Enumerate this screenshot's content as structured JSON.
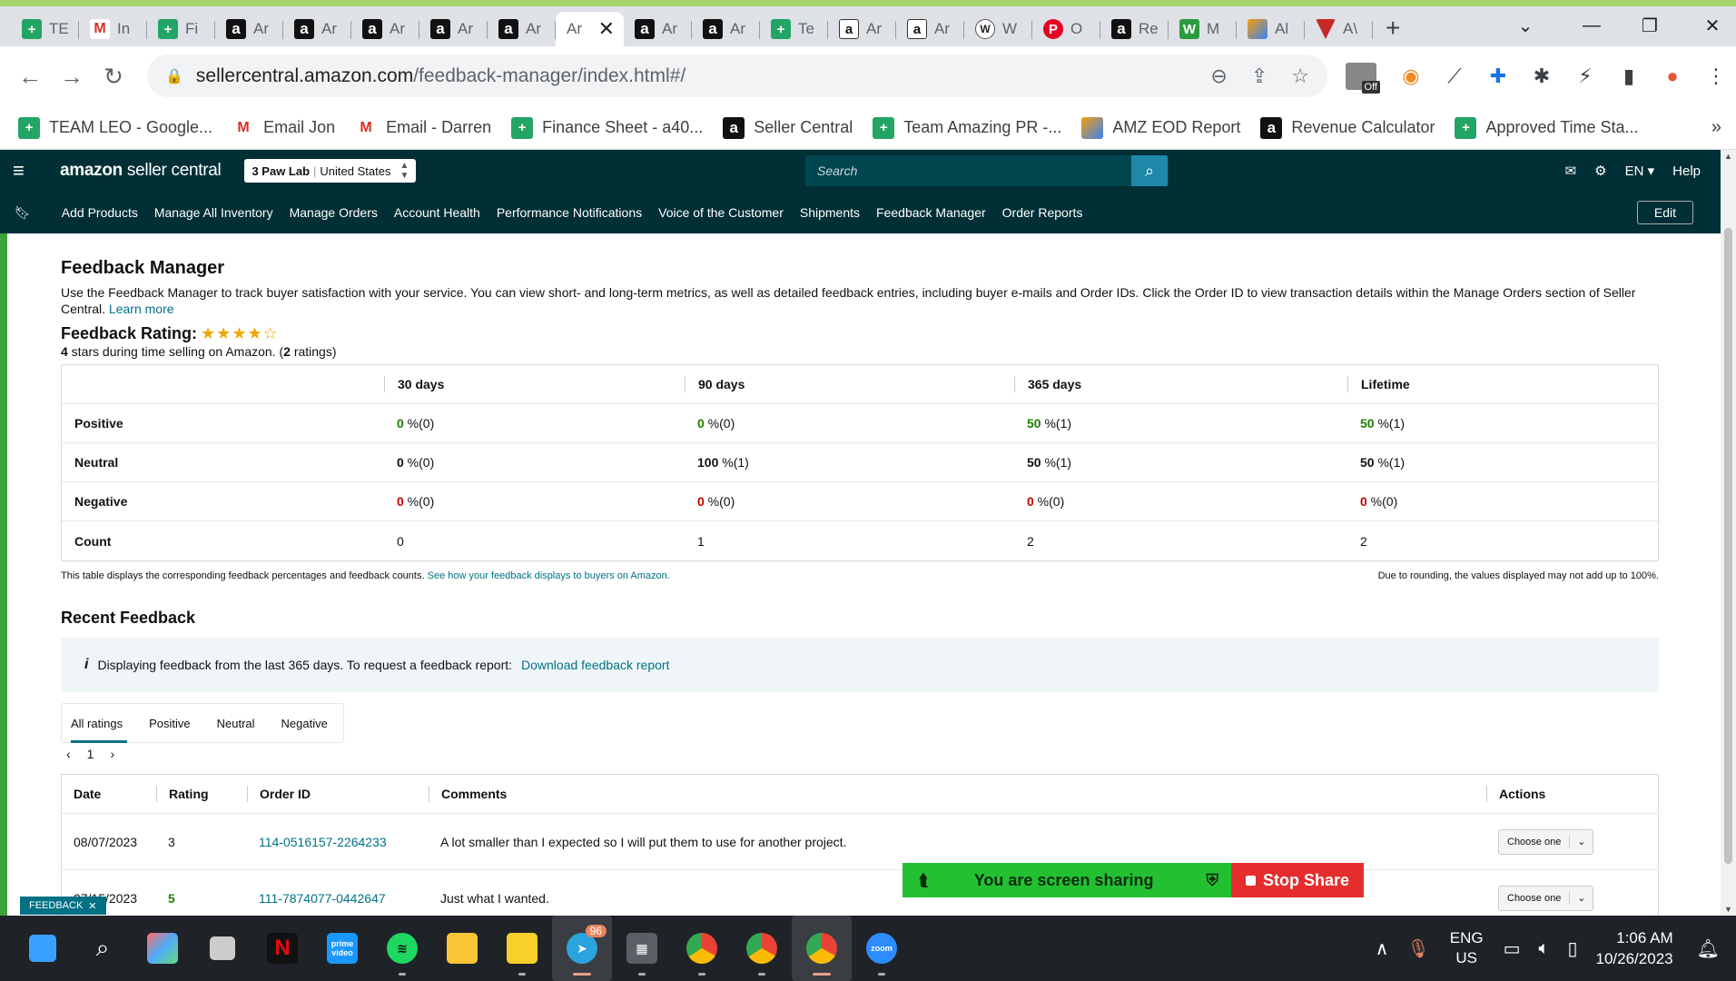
{
  "browser": {
    "tabs": [
      {
        "label": "TE",
        "icon": "sheets"
      },
      {
        "label": "In",
        "icon": "gmail"
      },
      {
        "label": "Fi",
        "icon": "sheets"
      },
      {
        "label": "Ar",
        "icon": "amazon"
      },
      {
        "label": "Ar",
        "icon": "amazon"
      },
      {
        "label": "Ar",
        "icon": "amazon"
      },
      {
        "label": "Ar",
        "icon": "amazon"
      },
      {
        "label": "Ar",
        "icon": "amazon"
      },
      {
        "label": "Ar",
        "icon": "none",
        "active": true
      },
      {
        "label": "Ar",
        "icon": "amazon"
      },
      {
        "label": "Ar",
        "icon": "amazon"
      },
      {
        "label": "Te",
        "icon": "sheets"
      },
      {
        "label": "Ar",
        "icon": "amazon-white"
      },
      {
        "label": "Ar",
        "icon": "amazon-white"
      },
      {
        "label": "W",
        "icon": "w"
      },
      {
        "label": "O",
        "icon": "pinterest"
      },
      {
        "label": "Re",
        "icon": "amazon"
      },
      {
        "label": "M",
        "icon": "green"
      },
      {
        "label": "Al",
        "icon": "multi"
      },
      {
        "label": "A\\",
        "icon": "shield"
      }
    ],
    "url_host": "sellercentral.amazon.com",
    "url_path": "/feedback-manager/index.html#/",
    "bookmarks": [
      {
        "label": "TEAM LEO - Google...",
        "icon": "sheets"
      },
      {
        "label": "Email Jon",
        "icon": "gmail"
      },
      {
        "label": "Email - Darren",
        "icon": "gmail"
      },
      {
        "label": "Finance Sheet - a40...",
        "icon": "sheets"
      },
      {
        "label": "Seller Central",
        "icon": "amazon"
      },
      {
        "label": "Team Amazing PR -...",
        "icon": "sheets"
      },
      {
        "label": "AMZ EOD Report",
        "icon": "multi"
      },
      {
        "label": "Revenue Calculator",
        "icon": "amazon"
      },
      {
        "label": "Approved Time Sta...",
        "icon": "sheets"
      }
    ],
    "ext_off_badge": "Off"
  },
  "header": {
    "brand_bold": "amazon",
    "brand_rest": " seller central",
    "store_name": "3 Paw Lab",
    "store_region": "United States",
    "search_placeholder": "Search",
    "lang": "EN",
    "help": "Help",
    "nav": [
      "Add Products",
      "Manage All Inventory",
      "Manage Orders",
      "Account Health",
      "Performance Notifications",
      "Voice of the Customer",
      "Shipments",
      "Feedback Manager",
      "Order Reports"
    ],
    "edit": "Edit"
  },
  "page": {
    "title": "Feedback Manager",
    "description": "Use the Feedback Manager to track buyer satisfaction with your service. You can view short- and long-term metrics, as well as detailed feedback entries, including buyer e-mails and Order IDs. Click the Order ID to view transaction details within the Manage Orders section of Seller Central.",
    "learn_more": "Learn more",
    "rating_label": "Feedback Rating:",
    "stars_filled": 4,
    "stars_total": 5,
    "rating_stars": "4",
    "rating_text_a": " stars during time selling on Amazon. (",
    "rating_count": "2",
    "rating_text_b": " ratings)",
    "metrics": {
      "columns": [
        "",
        "30 days",
        "90 days",
        "365 days",
        "Lifetime"
      ],
      "rows": [
        {
          "label": "Positive",
          "cells": [
            {
              "v": "0",
              "s": " %(0)",
              "c": "g"
            },
            {
              "v": "0",
              "s": " %(0)",
              "c": "g"
            },
            {
              "v": "50",
              "s": " %(1)",
              "c": "g"
            },
            {
              "v": "50",
              "s": " %(1)",
              "c": "g"
            }
          ]
        },
        {
          "label": "Neutral",
          "cells": [
            {
              "v": "0",
              "s": " %(0)",
              "c": "nb"
            },
            {
              "v": "100",
              "s": " %(1)",
              "c": "nb"
            },
            {
              "v": "50",
              "s": " %(1)",
              "c": "nb"
            },
            {
              "v": "50",
              "s": " %(1)",
              "c": "nb"
            }
          ]
        },
        {
          "label": "Negative",
          "cells": [
            {
              "v": "0",
              "s": " %(0)",
              "c": "r"
            },
            {
              "v": "0",
              "s": " %(0)",
              "c": "r"
            },
            {
              "v": "0",
              "s": " %(0)",
              "c": "r"
            },
            {
              "v": "0",
              "s": " %(0)",
              "c": "r"
            }
          ]
        },
        {
          "label": "Count",
          "cells": [
            {
              "v": "0",
              "s": "",
              "c": ""
            },
            {
              "v": "1",
              "s": "",
              "c": ""
            },
            {
              "v": "2",
              "s": "",
              "c": ""
            },
            {
              "v": "2",
              "s": "",
              "c": ""
            }
          ]
        }
      ]
    },
    "foot_left": "This table displays the corresponding feedback percentages and feedback counts.",
    "foot_left_link": "See how your feedback displays to buyers on Amazon.",
    "foot_right": "Due to rounding, the values displayed may not add up to 100%.",
    "recent_title": "Recent Feedback",
    "info_icon": "i",
    "info_text": "Displaying feedback from the last 365 days. To request a feedback report:",
    "info_link": "Download feedback report",
    "filter_tabs": [
      "All ratings",
      "Positive",
      "Neutral",
      "Negative"
    ],
    "page_num": "1",
    "feedback_columns": [
      "Date",
      "Rating",
      "Order ID",
      "Comments",
      "Actions"
    ],
    "feedback_rows": [
      {
        "date": "08/07/2023",
        "rating": "3",
        "order": "114-0516157-2264233",
        "comment": "A lot smaller than I expected so I will put them to use for another project.",
        "action": "Choose one"
      },
      {
        "date": "07/15/2023",
        "rating": "5",
        "order": "111-7874077-0442647",
        "comment": "Just what I wanted.",
        "action": "Choose one"
      }
    ]
  },
  "overlay": {
    "feedback_tab": "FEEDBACK",
    "feedback_close": "✕",
    "sharing_text": "You are screen sharing",
    "stop_share": "Stop Share"
  },
  "taskbar": {
    "telegram_badge": "96",
    "lang_top": "ENG",
    "lang_bottom": "US",
    "time": "1:06 AM",
    "date": "10/26/2023"
  },
  "colors": {
    "brand_dark": "#002f36",
    "link": "#007185",
    "positive": "#1d8102",
    "negative": "#c40000",
    "share_green": "#23c132",
    "share_red": "#e52d2d"
  }
}
